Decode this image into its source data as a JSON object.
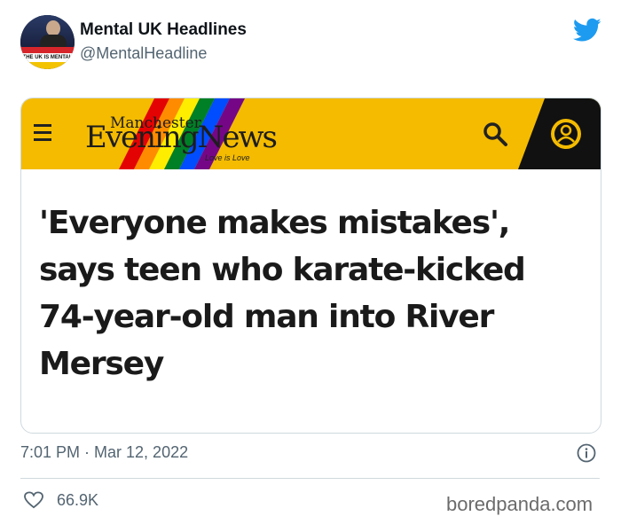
{
  "header": {
    "display_name": "Mental UK Headlines",
    "handle": "@MentalHeadline",
    "avatar_caption": "THE UK IS MENTAL"
  },
  "image": {
    "masthead_small": "Manchester",
    "masthead_big": "EveningNews",
    "tagline": "Love is Love",
    "headline": "'Everyone makes mistakes', says teen who karate-kicked 74-year-old man into River Mersey",
    "bar_color": "#f4bb00"
  },
  "meta": {
    "timestamp": "7:01 PM · Mar 12, 2022"
  },
  "actions": {
    "likes": "66.9K"
  },
  "watermark": "boredpanda.com",
  "colors": {
    "twitter_blue": "#1d9bf0",
    "muted_text": "#536471",
    "divider": "#cfd9de"
  },
  "icons": [
    "twitter-bird-icon",
    "hamburger-menu-icon",
    "search-icon",
    "account-icon",
    "info-icon",
    "heart-icon"
  ]
}
